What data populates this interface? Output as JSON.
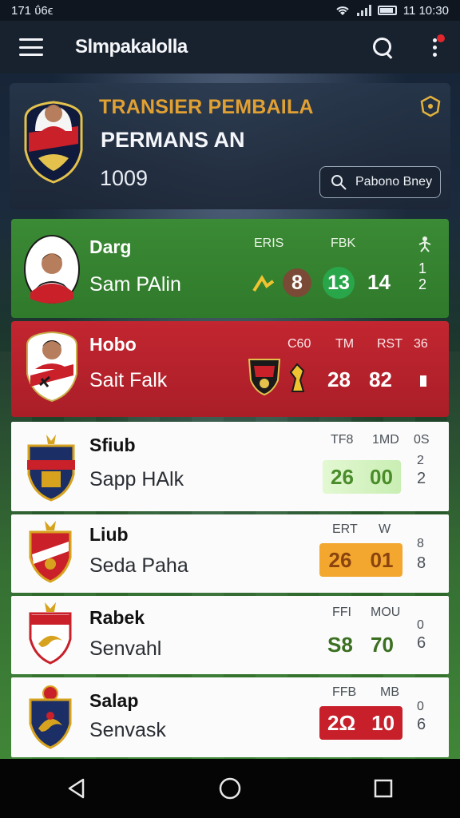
{
  "status_bar": {
    "time": "171 ΰ6ϵ",
    "clock": "11 10:30"
  },
  "app_bar": {
    "title": "Slmpakalolla"
  },
  "featured": {
    "label": "TRANSIER PEMBAILA",
    "subtitle": "PERMANS AN",
    "value": "1009",
    "button_label": "Pabono Bney"
  },
  "rows": [
    {
      "name1": "Darg",
      "name2": "Sam PAlin",
      "headers": [
        "ERIS",
        "FBK"
      ],
      "values": [
        "8",
        "13",
        "14"
      ],
      "side": [
        "1",
        "2"
      ],
      "colors": {
        "bg": "#3b8a35",
        "value_badge_1": "#7a4a36",
        "value_badge_2": "#2aa64a"
      }
    },
    {
      "name1": "Hobo",
      "name2": "Sait Falk",
      "headers": [
        "C60",
        "TM",
        "RST",
        "36"
      ],
      "values": [
        "28",
        "82"
      ],
      "colors": {
        "bg": "#c22630"
      }
    },
    {
      "name1": "Sfiub",
      "name2": "Sapp HAlk",
      "headers": [
        "TF8",
        "1MD",
        "0S"
      ],
      "values": [
        "26",
        "00"
      ],
      "side": [
        "2",
        "2"
      ],
      "colors": {
        "pill": "#d9f3c7",
        "text": "#4a8c2a"
      }
    },
    {
      "name1": "Liub",
      "name2": "Seda Paha",
      "headers": [
        "ERT",
        "W"
      ],
      "values": [
        "26",
        "01"
      ],
      "side": [
        "8",
        "8"
      ],
      "colors": {
        "pill": "#f3a72e",
        "text": "#a04d10"
      }
    },
    {
      "name1": "Rabek",
      "name2": "Senvahl",
      "headers": [
        "FFI",
        "MOU"
      ],
      "values": [
        "S8",
        "70"
      ],
      "side": [
        "0",
        "6"
      ],
      "colors": {
        "text": "#3b6f21"
      }
    },
    {
      "name1": "Salap",
      "name2": "Senvask",
      "headers": [
        "FFB",
        "MB"
      ],
      "values": [
        "2Ω",
        "10"
      ],
      "side": [
        "0",
        "6"
      ],
      "colors": {
        "pill": "#c8202a",
        "text": "#ffffff"
      }
    }
  ],
  "nav": {
    "back_icon": "back-triangle-icon",
    "home_icon": "home-circle-icon",
    "recents_icon": "recents-square-icon"
  }
}
